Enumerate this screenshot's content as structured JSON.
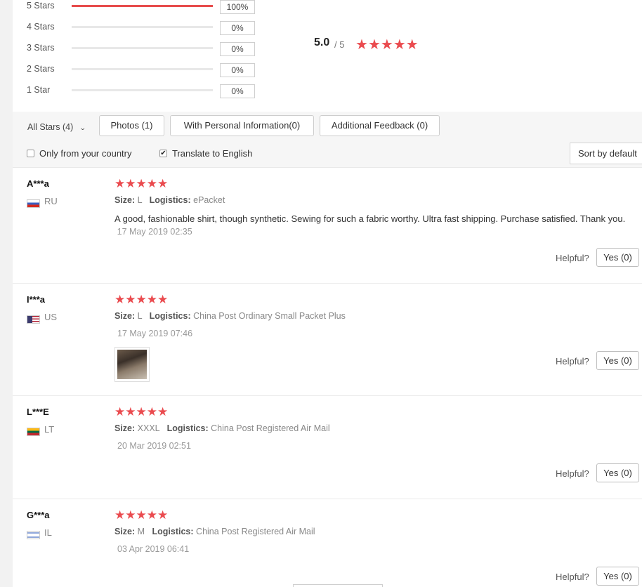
{
  "histogram": [
    {
      "label": "5 Stars",
      "percent": "100%",
      "fill": 1.0
    },
    {
      "label": "4 Stars",
      "percent": "0%",
      "fill": 0
    },
    {
      "label": "3 Stars",
      "percent": "0%",
      "fill": 0
    },
    {
      "label": "2 Stars",
      "percent": "0%",
      "fill": 0
    },
    {
      "label": "1 Star",
      "percent": "0%",
      "fill": 0
    }
  ],
  "summary": {
    "average": "5.0",
    "out_of": "/ 5",
    "stars": 5
  },
  "filters": {
    "all_stars": "All Stars (4)",
    "photos": "Photos (1)",
    "personal": "With Personal Information(0)",
    "additional": "Additional Feedback (0)",
    "only_country": "Only from your country",
    "only_country_checked": false,
    "translate": "Translate to English",
    "translate_checked": true,
    "sort": "Sort by default"
  },
  "colors": {
    "accent": "#e74c4c",
    "star": "#ea4b4f"
  },
  "reviews": [
    {
      "name": "A***a",
      "country": "RU",
      "flag": "flag-ru-icon",
      "stars": 5,
      "size_label": "Size:",
      "size": "L",
      "logistics_label": "Logistics:",
      "logistics": "ePacket",
      "text": "A good, fashionable shirt, though synthetic. Sewing for such a fabric worthy. Ultra fast shipping. Purchase satisfied. Thank you.",
      "date": "17 May 2019 02:35",
      "helpful": "Helpful?",
      "yes": "Yes (0)"
    },
    {
      "name": "I***a",
      "country": "US",
      "flag": "flag-us-icon",
      "stars": 5,
      "size_label": "Size:",
      "size": "L",
      "logistics_label": "Logistics:",
      "logistics": "China Post Ordinary Small Packet Plus",
      "date": "17 May 2019 07:46",
      "has_photo": true,
      "helpful": "Helpful?",
      "yes": "Yes (0)"
    },
    {
      "name": "L***E",
      "country": "LT",
      "flag": "flag-lt-icon",
      "stars": 5,
      "size_label": "Size:",
      "size": "XXXL",
      "logistics_label": "Logistics:",
      "logistics": "China Post Registered Air Mail",
      "date": "20 Mar 2019 02:51",
      "helpful": "Helpful?",
      "yes": "Yes (0)"
    },
    {
      "name": "G***a",
      "country": "IL",
      "flag": "flag-il-icon",
      "stars": 5,
      "size_label": "Size:",
      "size": "M",
      "logistics_label": "Logistics:",
      "logistics": "China Post Registered Air Mail",
      "date": "03 Apr 2019 06:41",
      "helpful": "Helpful?",
      "yes": "Yes (0)"
    }
  ]
}
